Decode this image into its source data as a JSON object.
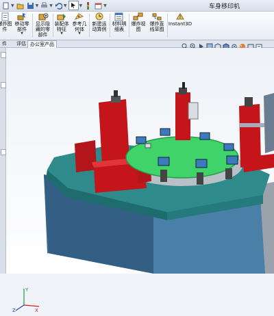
{
  "window": {
    "title": "车身移印机"
  },
  "quick_access": {
    "icons": [
      "new-icon",
      "open-icon",
      "save-icon",
      "print-icon",
      "undo-icon",
      "select-icon",
      "rebuild-icon",
      "options-icon"
    ]
  },
  "ribbon": {
    "buttons": [
      {
        "label": "爆炸图\n件",
        "icon": "document-icon"
      },
      {
        "label": "移动零\n部件",
        "icon": "move-component-icon"
      },
      {
        "label": "显示隐\n藏的零\n部件",
        "icon": "show-hidden-icon"
      },
      {
        "label": "装配体\n特征",
        "icon": "assembly-feature-icon"
      },
      {
        "label": "参考几\n何体",
        "icon": "reference-geometry-icon"
      },
      {
        "label": "新建运\n动算例",
        "icon": "motion-study-icon"
      },
      {
        "label": "材料明\n细表",
        "icon": "bom-icon"
      },
      {
        "label": "爆炸视\n图",
        "icon": "exploded-view-icon"
      },
      {
        "label": "爆炸直\n线草图",
        "icon": "explode-line-icon"
      },
      {
        "label": "Instant3D",
        "icon": "instant3d-icon"
      }
    ]
  },
  "tabs": [
    {
      "label": "件",
      "selected": false
    },
    {
      "label": "评估",
      "selected": false
    },
    {
      "label": "办公室产品",
      "selected": true
    }
  ],
  "view_toolbar": {
    "icons": [
      "zoom-to-fit-icon",
      "zoom-area-icon",
      "previous-view-icon",
      "section-view-icon",
      "view-orientation-icon",
      "display-style-icon",
      "hide-show-icon",
      "appearance-icon",
      "scene-icon",
      "view-settings-icon"
    ]
  },
  "colors": {
    "accent": "#2e6fb8",
    "frame_red": "#c4151a",
    "turntable_green": "#3fd36a",
    "base_teal": "#2f8a8c",
    "cabinet_blue": "#3c6f99"
  },
  "triad": {
    "labels": [
      "X",
      "Y",
      "Z"
    ]
  }
}
